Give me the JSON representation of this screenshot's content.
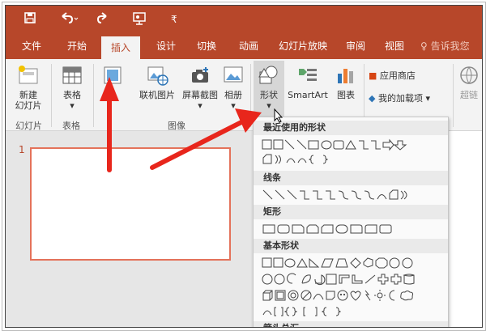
{
  "qat": {
    "save_icon": "save-icon",
    "undo_icon": "undo-icon",
    "redo_icon": "redo-icon",
    "start_icon": "present-from-start-icon",
    "customize_icon": "customize-qat-icon"
  },
  "tabs": [
    {
      "label": "文件"
    },
    {
      "label": "开始"
    },
    {
      "label": "插入"
    },
    {
      "label": "设计"
    },
    {
      "label": "切换"
    },
    {
      "label": "动画"
    },
    {
      "label": "幻灯片放映"
    },
    {
      "label": "审阅"
    },
    {
      "label": "视图"
    }
  ],
  "tell_me": "♀ 告诉我您",
  "ribbon": {
    "new_slide": "新建",
    "new_slide_2": "幻灯片",
    "slides_group": "幻灯片",
    "table": "表格",
    "tables_group": "表格",
    "online_pictures": "联机图片",
    "screenshot": "屏幕截图",
    "album": "相册",
    "images_group": "图像",
    "shapes": "形状",
    "smartart": "SmartArt",
    "chart": "图表",
    "store": "应用商店",
    "my_addins": "我的加载项",
    "hyperlink": "超链"
  },
  "slide": {
    "number": "1"
  },
  "shapes_menu": {
    "recent": "最近使用的形状",
    "lines": "线条",
    "rectangles": "矩形",
    "basic": "基本形状",
    "arrows": "箭头总汇"
  },
  "colors": {
    "accent": "#b7472a",
    "arrow": "#e8261c"
  }
}
